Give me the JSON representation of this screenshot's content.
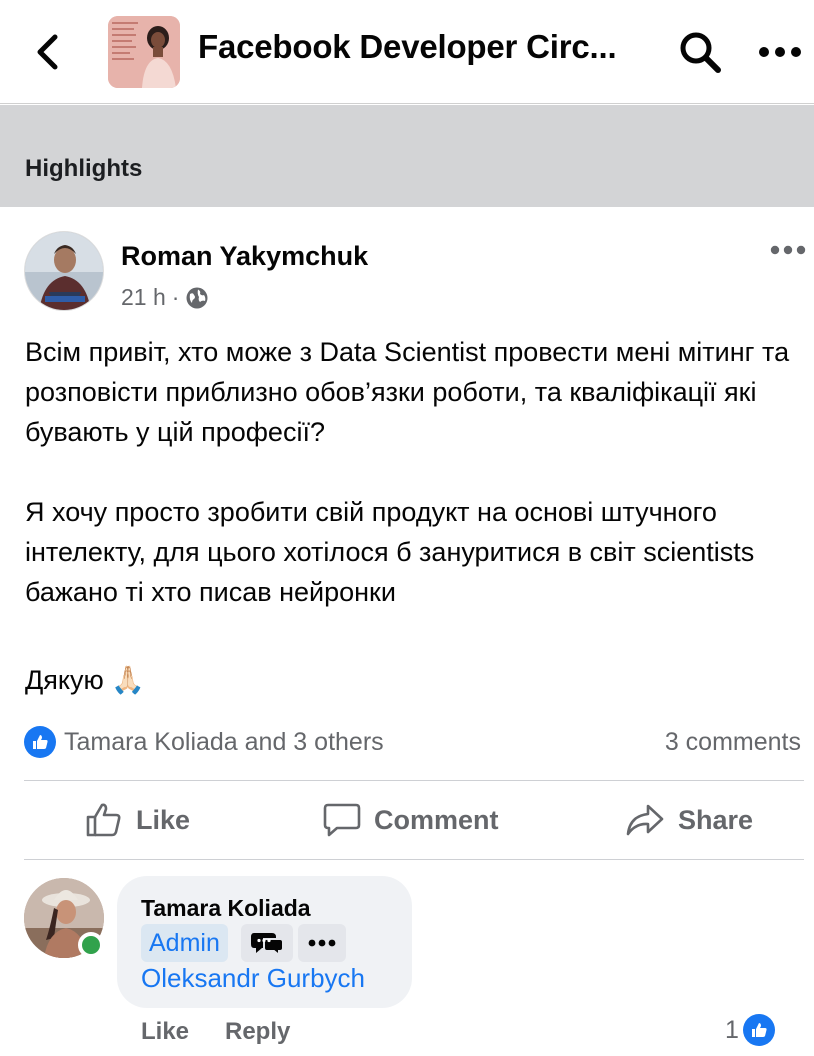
{
  "header": {
    "title": "Facebook Developer Circ...",
    "back_icon": "chevron-left-icon",
    "search_icon": "search-icon",
    "more_icon": "more-horizontal-icon"
  },
  "highlights": {
    "label": "Highlights"
  },
  "post": {
    "author": "Roman Yakymchuk",
    "time": "21 h",
    "separator": "·",
    "privacy_icon": "globe-icon",
    "body": {
      "p1": "Всім привіт, хто може з Data Scientist провести мені мітинг та розповісти приблизно обов’язки роботи, та кваліфікації які бувають у цій професії?",
      "p2": "Я хочу просто зробити свій продукт на основі штучного інтелекту, для цього хотілося б зануритися в світ scientists бажано ті хто писав нейронки",
      "p3": "Дякую 🙏🏻"
    },
    "reactions_text": "Tamara Koliada and 3 others",
    "comments_count": "3 comments",
    "actions": {
      "like": "Like",
      "comment": "Comment",
      "share": "Share"
    }
  },
  "comment": {
    "author": "Tamara Koliada",
    "badge_admin": "Admin",
    "text": "Oleksandr Gurbych",
    "like": "Like",
    "reply": "Reply",
    "reaction_count": "1"
  },
  "colors": {
    "accent": "#1877f2",
    "secondary_text": "#65676b",
    "highlights_bg": "#d3d4d6",
    "bubble_bg": "#f0f2f5",
    "online": "#31a24c"
  }
}
